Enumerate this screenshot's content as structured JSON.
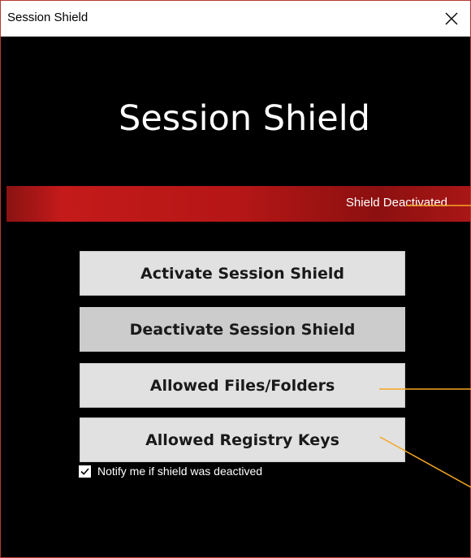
{
  "window": {
    "title": "Session Shield",
    "close_icon": "close-icon"
  },
  "app": {
    "heading": "Session Shield",
    "status": "Shield Deactivated"
  },
  "buttons": {
    "activate": "Activate Session Shield",
    "deactivate": "Deactivate Session Shield",
    "allowed_files": "Allowed Files/Folders",
    "allowed_registry": "Allowed Registry Keys"
  },
  "options": {
    "notify_label": "Notify me if shield was deactived",
    "notify_checked": true
  },
  "colors": {
    "status_bar": "#b51616",
    "window_bg": "#000000",
    "button_bg": "#e1e1e1",
    "annotation_line": "#f5a623"
  }
}
